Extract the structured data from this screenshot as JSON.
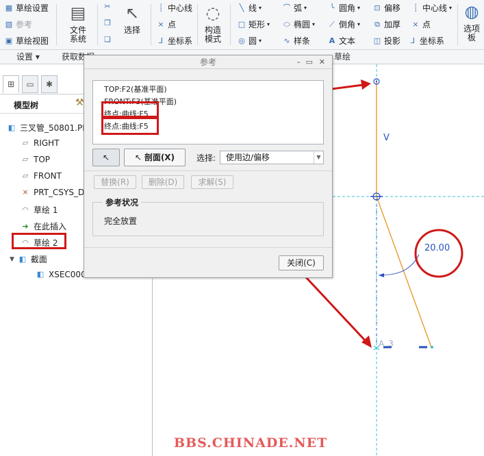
{
  "ribbon": {
    "settings": {
      "sketch_setup": "草绘设置",
      "references": "参考",
      "sketch_view": "草绘视图",
      "group": "设置"
    },
    "file_system": "文件系统",
    "select": "选择",
    "get_data_group": "获取数据",
    "datum": {
      "centerline": "中心线",
      "point": "点",
      "csys": "坐标系"
    },
    "construction_mode": "构造模式",
    "sketching": {
      "line": "线",
      "arc": "弧",
      "fillet": "圆角",
      "offset": "偏移",
      "centerline": "中心线",
      "rectangle": "矩形",
      "ellipse": "椭圆",
      "chamfer": "倒角",
      "thicken": "加厚",
      "point": "点",
      "circle": "圆",
      "spline": "样条",
      "text": "文本",
      "project": "投影",
      "csys": "坐标系",
      "group": "草绘"
    },
    "palette": "选项板"
  },
  "model_tree": {
    "header": "模型树",
    "items": [
      {
        "label": "三叉管_50801.PR",
        "icon": "part-icon"
      },
      {
        "label": "RIGHT",
        "icon": "datum-plane-icon"
      },
      {
        "label": "TOP",
        "icon": "datum-plane-icon"
      },
      {
        "label": "FRONT",
        "icon": "datum-plane-icon"
      },
      {
        "label": "PRT_CSYS_D",
        "icon": "csys-icon"
      },
      {
        "label": "草绘 1",
        "icon": "sketch-icon"
      },
      {
        "label": "在此插入",
        "icon": "insert-here-arrow-icon"
      },
      {
        "label": "草绘 2",
        "icon": "sketch-icon"
      },
      {
        "label": "截面",
        "icon": "section-icon"
      },
      {
        "label": "XSEC000",
        "icon": "xsec-icon"
      }
    ]
  },
  "dialog": {
    "title": "参考",
    "references": [
      "TOP:F2(基准平面)",
      "FRONT:F3(基准平面)",
      "终点:曲线:F5",
      "终点:曲线:F5"
    ],
    "section_button": "剖面(X)",
    "select_label": "选择:",
    "select_value": "使用边/偏移",
    "replace_button": "替换(R)",
    "delete_button": "删除(D)",
    "solve_button": "求解(S)",
    "status_legend": "参考状况",
    "status_text": "完全放置",
    "close_button": "关闭(C)"
  },
  "canvas": {
    "label_v": "V",
    "dimension": "20.00",
    "label_a3": "A_3"
  },
  "watermark": "BBS.CHINADE.NET",
  "colors": {
    "highlight": "#d01818",
    "orange_line": "#e8a23c",
    "cyan_dash": "#3cc0d8"
  }
}
